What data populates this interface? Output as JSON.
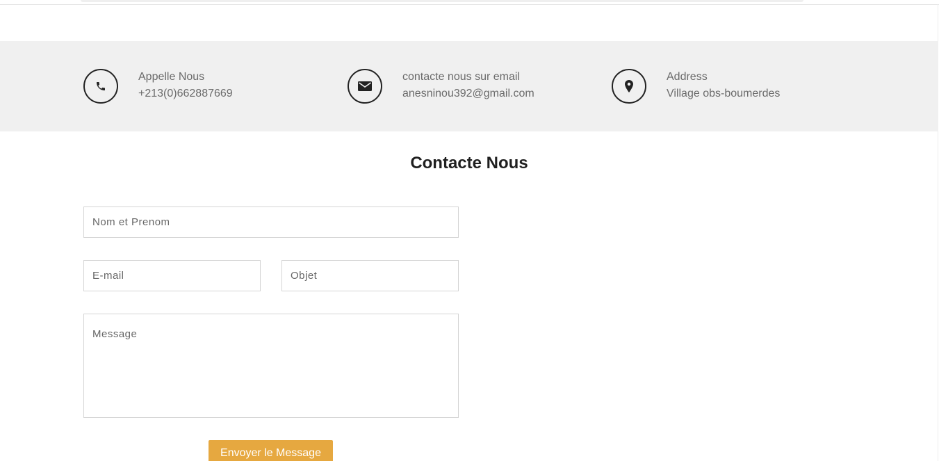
{
  "contact_info": [
    {
      "icon": "phone-icon",
      "label": "Appelle Nous",
      "value": "+213(0)662887669"
    },
    {
      "icon": "envelope-icon",
      "label": "contacte nous sur email",
      "value": "anesninou392@gmail.com"
    },
    {
      "icon": "map-marker-icon",
      "label": "Address",
      "value": "Village obs-boumerdes"
    }
  ],
  "form": {
    "title": "Contacte Nous",
    "name_placeholder": "Nom et Prenom",
    "email_placeholder": "E-mail",
    "subject_placeholder": "Objet",
    "message_placeholder": "Message",
    "submit_label": "Envoyer le Message"
  },
  "colors": {
    "band_background": "#f0f0f0",
    "accent": "#e6a840",
    "icon_stroke": "#222222"
  }
}
